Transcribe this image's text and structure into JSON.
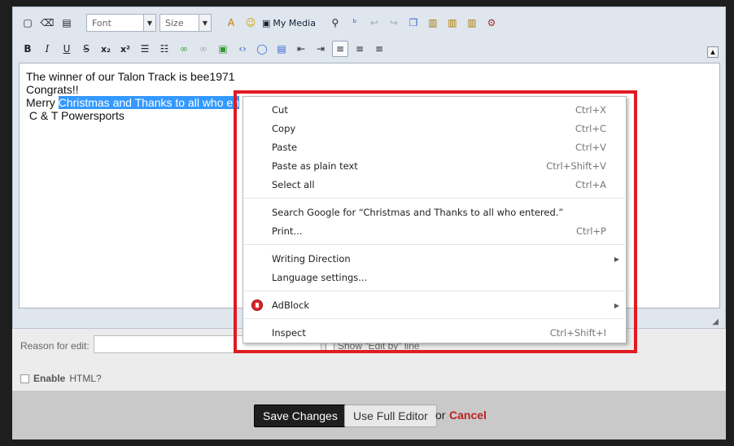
{
  "toolbar": {
    "font_label": "Font",
    "size_label": "Size",
    "my_media_label": "My Media"
  },
  "editor": {
    "line1": "The winner of our Talon Track is bee1971",
    "line2": "Congrats!!",
    "line3_prefix": "Merry ",
    "line3_selected": "Christmas and Thanks to all who en",
    "line4": " C & T Powersports"
  },
  "form": {
    "reason_label": "Reason for edit:",
    "show_edit_label": "Show \"Edit by\" line",
    "enable_html_label": "Enable",
    "enable_html_suffix": "HTML?"
  },
  "footer": {
    "save_label": "Save Changes",
    "full_editor_label": "Use Full Editor",
    "or_text": "or",
    "cancel_label": "Cancel"
  },
  "context_menu": {
    "cut": {
      "label": "Cut",
      "shortcut": "Ctrl+X"
    },
    "copy": {
      "label": "Copy",
      "shortcut": "Ctrl+C"
    },
    "paste": {
      "label": "Paste",
      "shortcut": "Ctrl+V"
    },
    "paste_plain": {
      "label": "Paste as plain text",
      "shortcut": "Ctrl+Shift+V"
    },
    "select_all": {
      "label": "Select all",
      "shortcut": "Ctrl+A"
    },
    "search": {
      "label": "Search Google for “Christmas and Thanks to all who entered.”"
    },
    "print": {
      "label": "Print...",
      "shortcut": "Ctrl+P"
    },
    "writing_direction": {
      "label": "Writing Direction"
    },
    "language_settings": {
      "label": "Language settings..."
    },
    "adblock": {
      "label": "AdBlock"
    },
    "inspect": {
      "label": "Inspect",
      "shortcut": "Ctrl+Shift+I"
    }
  },
  "colors": {
    "highlight_border": "#e01b22",
    "selection": "#3399ff",
    "cancel": "#bb2222"
  }
}
